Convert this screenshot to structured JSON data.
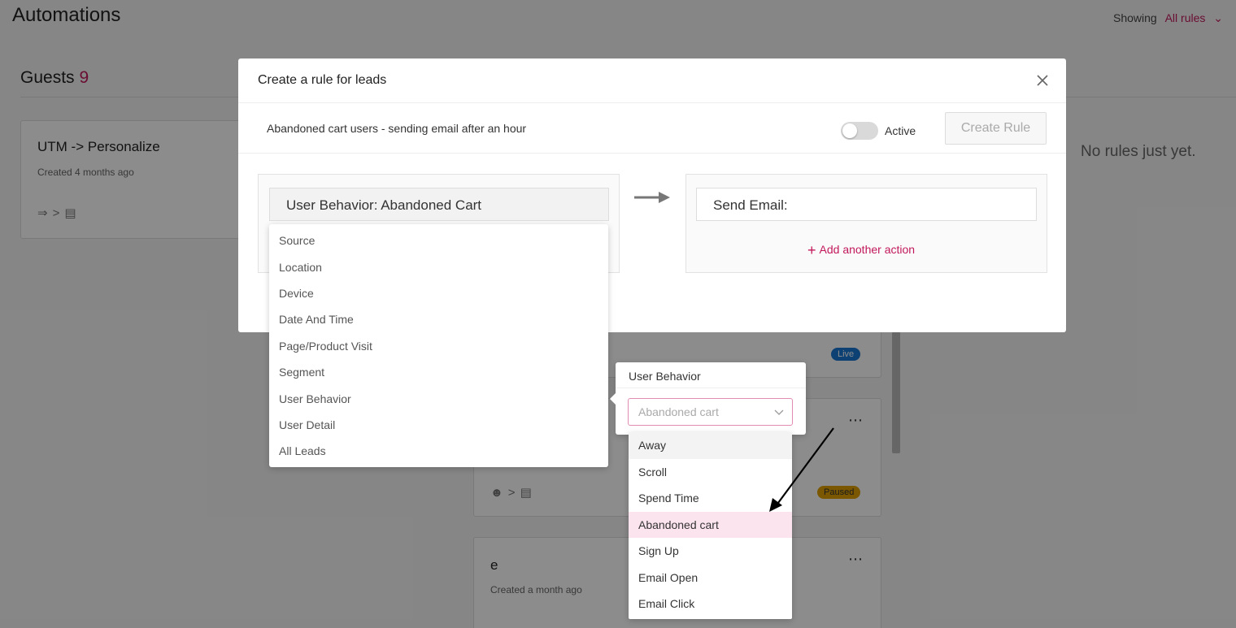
{
  "page": {
    "title": "Automations",
    "showing_label": "Showing",
    "showing_value": "All rules",
    "guests_label": "Guests",
    "guests_count": "9",
    "no_rules": "No rules just yet."
  },
  "cards": [
    {
      "title": "UTM -> Personalize",
      "meta": "Created 4 months ago"
    },
    {
      "badge": "Live"
    },
    {
      "badge": "Paused"
    },
    {
      "title": "e",
      "meta": "Created a month ago"
    }
  ],
  "modal": {
    "title": "Create a rule for leads",
    "rule_name": "Abandoned cart users - sending email after an hour",
    "active_label": "Active",
    "create_button": "Create Rule",
    "condition_value": "User Behavior: Abandoned Cart",
    "action_value": "Send Email:",
    "add_action": "Add another action"
  },
  "category_menu": {
    "items": [
      "Source",
      "Location",
      "Device",
      "Date And Time",
      "Page/Product Visit",
      "Segment",
      "User Behavior",
      "User Detail",
      "All Leads"
    ]
  },
  "popover": {
    "title": "User Behavior",
    "select_value": "Abandoned cart"
  },
  "options": {
    "items": [
      "Away",
      "Scroll",
      "Spend Time",
      "Abandoned cart",
      "Sign Up",
      "Email Open",
      "Email Click"
    ],
    "hovered": "Away",
    "selected": "Abandoned cart"
  },
  "colors": {
    "accent": "#c2185b",
    "live": "#1976d2",
    "paused": "#e0a100",
    "selected_bg": "#fce4ef"
  }
}
